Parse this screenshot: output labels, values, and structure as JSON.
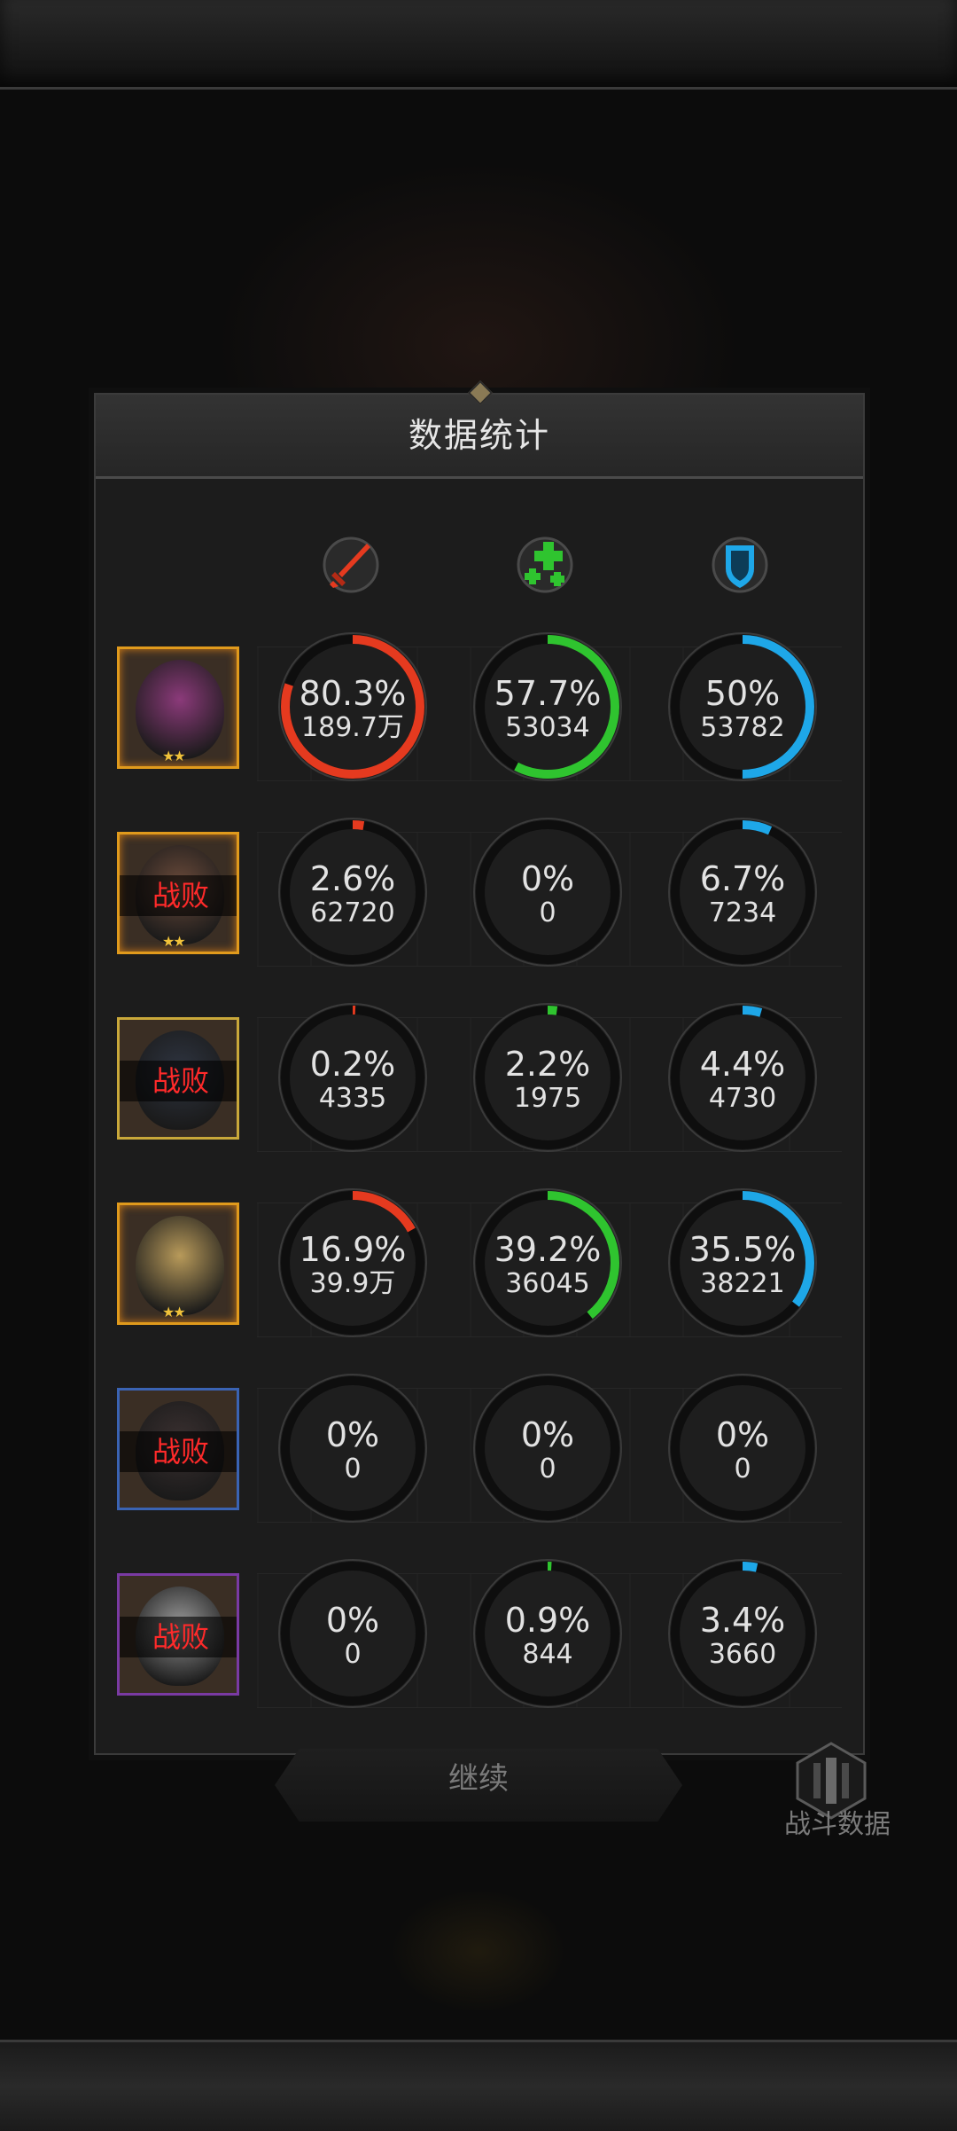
{
  "panel": {
    "title": "数据统计"
  },
  "columns": [
    {
      "icon": "sword-icon",
      "color": "#e53a1f"
    },
    {
      "icon": "heal-plus-icon",
      "color": "#2fc42f"
    },
    {
      "icon": "shield-icon",
      "color": "#1ea7e8"
    }
  ],
  "heroes": [
    {
      "frame": "gold",
      "defeated": "",
      "stars": "★★",
      "stats": [
        {
          "pct": "80.3%",
          "value": "189.7万",
          "fraction": 0.803
        },
        {
          "pct": "57.7%",
          "value": "53034",
          "fraction": 0.577
        },
        {
          "pct": "50%",
          "value": "53782",
          "fraction": 0.5
        }
      ]
    },
    {
      "frame": "gold",
      "defeated": "战败",
      "stars": "★★",
      "stats": [
        {
          "pct": "2.6%",
          "value": "62720",
          "fraction": 0.026
        },
        {
          "pct": "0%",
          "value": "0",
          "fraction": 0
        },
        {
          "pct": "6.7%",
          "value": "7234",
          "fraction": 0.067
        }
      ]
    },
    {
      "frame": "yellow",
      "defeated": "战败",
      "stars": "",
      "stats": [
        {
          "pct": "0.2%",
          "value": "4335",
          "fraction": 0.002
        },
        {
          "pct": "2.2%",
          "value": "1975",
          "fraction": 0.022
        },
        {
          "pct": "4.4%",
          "value": "4730",
          "fraction": 0.044
        }
      ]
    },
    {
      "frame": "gold",
      "defeated": "",
      "stars": "★★",
      "stats": [
        {
          "pct": "16.9%",
          "value": "39.9万",
          "fraction": 0.169
        },
        {
          "pct": "39.2%",
          "value": "36045",
          "fraction": 0.392
        },
        {
          "pct": "35.5%",
          "value": "38221",
          "fraction": 0.355
        }
      ]
    },
    {
      "frame": "blue",
      "defeated": "战败",
      "stars": "",
      "stats": [
        {
          "pct": "0%",
          "value": "0",
          "fraction": 0
        },
        {
          "pct": "0%",
          "value": "0",
          "fraction": 0
        },
        {
          "pct": "0%",
          "value": "0",
          "fraction": 0
        }
      ]
    },
    {
      "frame": "purple",
      "defeated": "战败",
      "stars": "",
      "stats": [
        {
          "pct": "0%",
          "value": "0",
          "fraction": 0
        },
        {
          "pct": "0.9%",
          "value": "844",
          "fraction": 0.009
        },
        {
          "pct": "3.4%",
          "value": "3660",
          "fraction": 0.034
        }
      ]
    }
  ],
  "footer": {
    "continue_label": "继续",
    "battle_data_label": "战斗数据"
  }
}
